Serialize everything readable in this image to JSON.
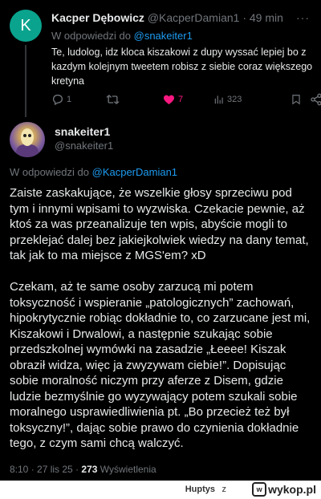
{
  "tweet1": {
    "avatar_letter": "K",
    "name": "Kacper Dębowicz",
    "handle": "@KacperDamian1",
    "separator": "·",
    "time": "49 min",
    "reply_prefix": "W odpowiedzi do",
    "reply_to": "@snakeiter1",
    "text": "Te, ludolog, idz kloca kiszakowi z dupy wyssać lepiej bo z kazdym kolejnym tweetem robisz z siebie coraz większego kretyna",
    "replies": "1",
    "retweets": "",
    "likes": "7",
    "views": "323",
    "more_icon": "···"
  },
  "tweet2": {
    "name": "snakeiter1",
    "handle": "@snakeiter1",
    "reply_prefix": "W odpowiedzi do",
    "reply_to": "@KacperDamian1",
    "paragraph1": "Zaiste zaskakujące, że wszelkie głosy sprzeciwu pod tym i innymi wpisami to wyzwiska. Czekacie pewnie, aż ktoś za was przeanalizuje ten wpis, abyście mogli to przeklejać dalej bez jakiejkolwiek wiedzy na dany temat, tak jak to ma miejsce z MGS'em? xD",
    "paragraph2": "Czekam, aż te same osoby zarzucą mi potem toksyczność i wspieranie „patologicznych” zachowań, hipokrytycznie robiąc dokładnie to, co zarzucane jest mi, Kiszakowi i Drwalowi, a następnie szukając sobie przedszkolnej wymówki na zasadzie „Łeeee! Kiszak obraził widza, więc ja zwyzywam ciebie!”. Dopisując sobie moralność niczym przy aferze z Disem, gdzie ludzie bezmyślnie go wyzywający potem szukali sobie moralnego usprawiedliwienia pt. „Bo przecież też był toksyczny!”, dając sobie prawo do czynienia dokładnie tego, z czym sami chcą walczyć.",
    "time": "8:10 · 27 lis 25 ·",
    "views_count": "273",
    "views_label": "Wyświetlenia"
  },
  "footer": {
    "user": "Huptys",
    "z": "z",
    "logo_text": "wykop.pl"
  },
  "colors": {
    "background": "#000000",
    "text": "#e7e9ea",
    "muted": "#71767b",
    "link": "#1d9bf0",
    "like": "#f91880",
    "avatar_k": "#0aa48e"
  }
}
